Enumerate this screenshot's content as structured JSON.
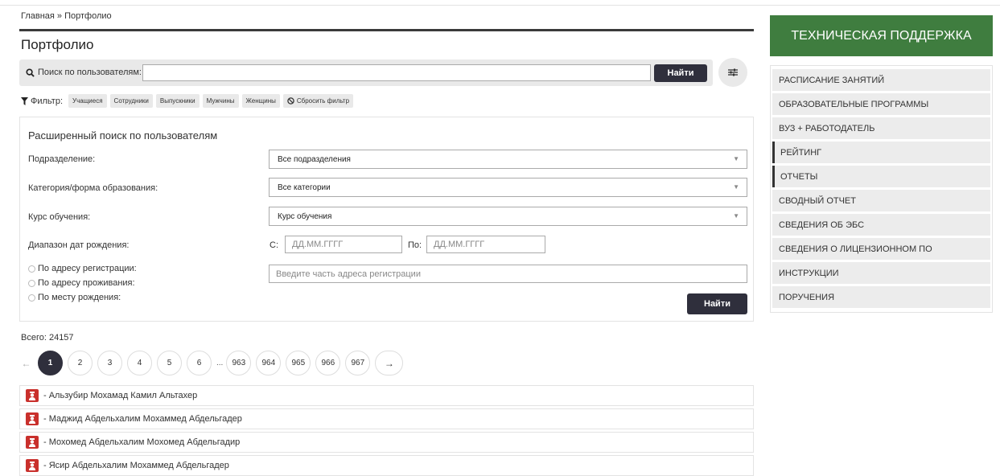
{
  "breadcrumb": {
    "home": "Главная",
    "sep": " » ",
    "current": "Портфолио"
  },
  "page_title": "Портфолио",
  "search": {
    "label": "Поиск по пользователям:",
    "value": "",
    "placeholder": "",
    "button": "Найти"
  },
  "filter": {
    "label": "Фильтр:",
    "chips": [
      "Учащиеся",
      "Сотрудники",
      "Выпускники",
      "Мужчины",
      "Женщины"
    ],
    "reset": "Сбросить фильтр"
  },
  "advanced": {
    "title": "Расширенный поиск по пользователям",
    "division": {
      "label": "Подразделение:",
      "value": "Все подразделения"
    },
    "category": {
      "label": "Категория/форма образования:",
      "value": "Все категории"
    },
    "course": {
      "label": "Курс обучения:",
      "value": "Курс обучения"
    },
    "birth": {
      "label": "Диапазон дат рождения:",
      "from_label": "С:",
      "to_label": "По:",
      "from_placeholder": "ДД.ММ.ГГГГ",
      "to_placeholder": "ДД.ММ.ГГГГ"
    },
    "address_options": [
      "По адресу регистрации:",
      "По адресу проживания:",
      "По месту рождения:"
    ],
    "address_placeholder": "Введите часть адреса регистрации",
    "button": "Найти"
  },
  "total": "Всего: 24157",
  "pagination": {
    "prev": "←",
    "pages_start": [
      "1",
      "2",
      "3",
      "4",
      "5",
      "6"
    ],
    "ellipsis": "...",
    "pages_end": [
      "963",
      "964",
      "965",
      "966",
      "967"
    ],
    "active": "1",
    "next": "→"
  },
  "users": [
    "- Альзубир Мохамад Камил Альтахер",
    "- Маджид Абдельхалим Мохаммед Абдельгадер",
    "- Мохомед Абдельхалим Мохомед Абдельгадир",
    "- Ясир Абдельхалим Мохаммед Абдельгадер"
  ],
  "sidebar": {
    "support": "ТЕХНИЧЕСКАЯ ПОДДЕРЖКА",
    "menu": [
      "РАСПИСАНИЕ ЗАНЯТИЙ",
      "ОБРАЗОВАТЕЛЬНЫЕ ПРОГРАММЫ",
      "ВУЗ + РАБОТОДАТЕЛЬ",
      "РЕЙТИНГ",
      "ОТЧЕТЫ",
      "СВОДНЫЙ ОТЧЕТ",
      "СВЕДЕНИЯ ОБ ЭБС",
      "СВЕДЕНИЯ О ЛИЦЕНЗИОННОМ ПО",
      "ИНСТРУКЦИИ",
      "ПОРУЧЕНИЯ"
    ],
    "marked_items": [
      "РЕЙТИНГ",
      "ОТЧЕТЫ"
    ]
  },
  "colors": {
    "support_bg": "#3f7d3f",
    "button_dark": "#2f2f3c",
    "avatar": "#c9302c"
  },
  "icons": {
    "search": "search-icon",
    "filter": "funnel-icon",
    "reset": "ban-icon",
    "settings": "sliders-icon",
    "user": "student-icon"
  }
}
